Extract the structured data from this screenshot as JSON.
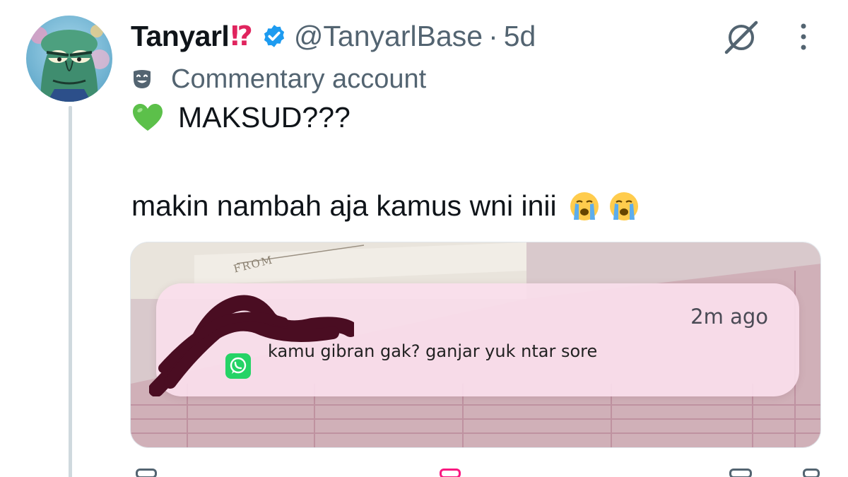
{
  "tweet": {
    "display_name": "Tanyarl",
    "name_emoji": "⁉",
    "verified_icon": "verified-badge-icon",
    "handle": "@TanyarlBase",
    "separator": "·",
    "time": "5d",
    "label": {
      "icon": "theater-mask-icon",
      "text": "Commentary account"
    },
    "text_line1": "MAKSUD???",
    "text_line2": "makin nambah aja kamus wni inii",
    "emoji": {
      "heart": "green-heart-icon",
      "cry": "loudly-crying-face-icon"
    },
    "media": {
      "stamp_text": "FROM",
      "notification": {
        "time": "2m ago",
        "message": "kamu gibran gak? ganjar yuk ntar sore",
        "app_icon": "whatsapp-icon"
      }
    }
  },
  "colors": {
    "brand_verified": "#1d9bf0",
    "text_secondary": "#536471",
    "heart_green": "#5cc04a",
    "whatsapp_green": "#25d366"
  }
}
